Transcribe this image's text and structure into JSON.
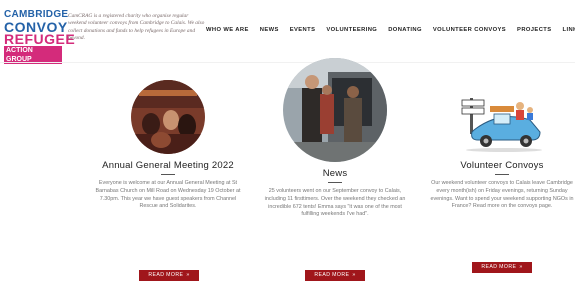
{
  "logo": {
    "line1": "CAMBRIDGE",
    "line2": "CONVOY",
    "line3": "REFUGEE",
    "line4": "ACTION GROUP"
  },
  "tagline": "CamCRAG is a registered charity who organise regular weekend volunteer convoys from Cambridge to Calais. We also collect donations and funds to help refugees in Europe and beyond.",
  "nav": {
    "items": [
      "WHO WE ARE",
      "NEWS",
      "EVENTS",
      "VOLUNTEERING",
      "DONATING",
      "VOLUNTEER CONVOYS",
      "PROJECTS",
      "LINKS"
    ]
  },
  "columns": [
    {
      "title": "Annual General Meeting 2022",
      "text": "Everyone is welcome at our Annual General Meeting at St Barnabas Church on Mill Road on Wednesday 19 October at 7.30pm. This year we have guest speakers from Channel Rescue and Solidarites.",
      "button": "READ MORE",
      "button_arrow": "»"
    },
    {
      "title": "News",
      "text": "25 volunteers went on our September convoy to Calais, including 11 firsttimers. Over the weekend they checked an incredible 672 tents! Emma says \"it was one of the most fulfilling weekends I've had\".",
      "button": "READ MORE",
      "button_arrow": "»"
    },
    {
      "title": "Volunteer Convoys",
      "text": "Our weekend volunteer convoys to Calais leave Cambridge every month(ish) on Friday evenings, returning Sunday evenings. Want to spend your weekend supporting NGOs in France? Read more on the convoys page.",
      "button": "READ MORE",
      "button_arrow": "»"
    }
  ],
  "colors": {
    "logo_blue": "#2462a8",
    "logo_pink": "#d42b7b",
    "button_red": "#a0161b"
  }
}
